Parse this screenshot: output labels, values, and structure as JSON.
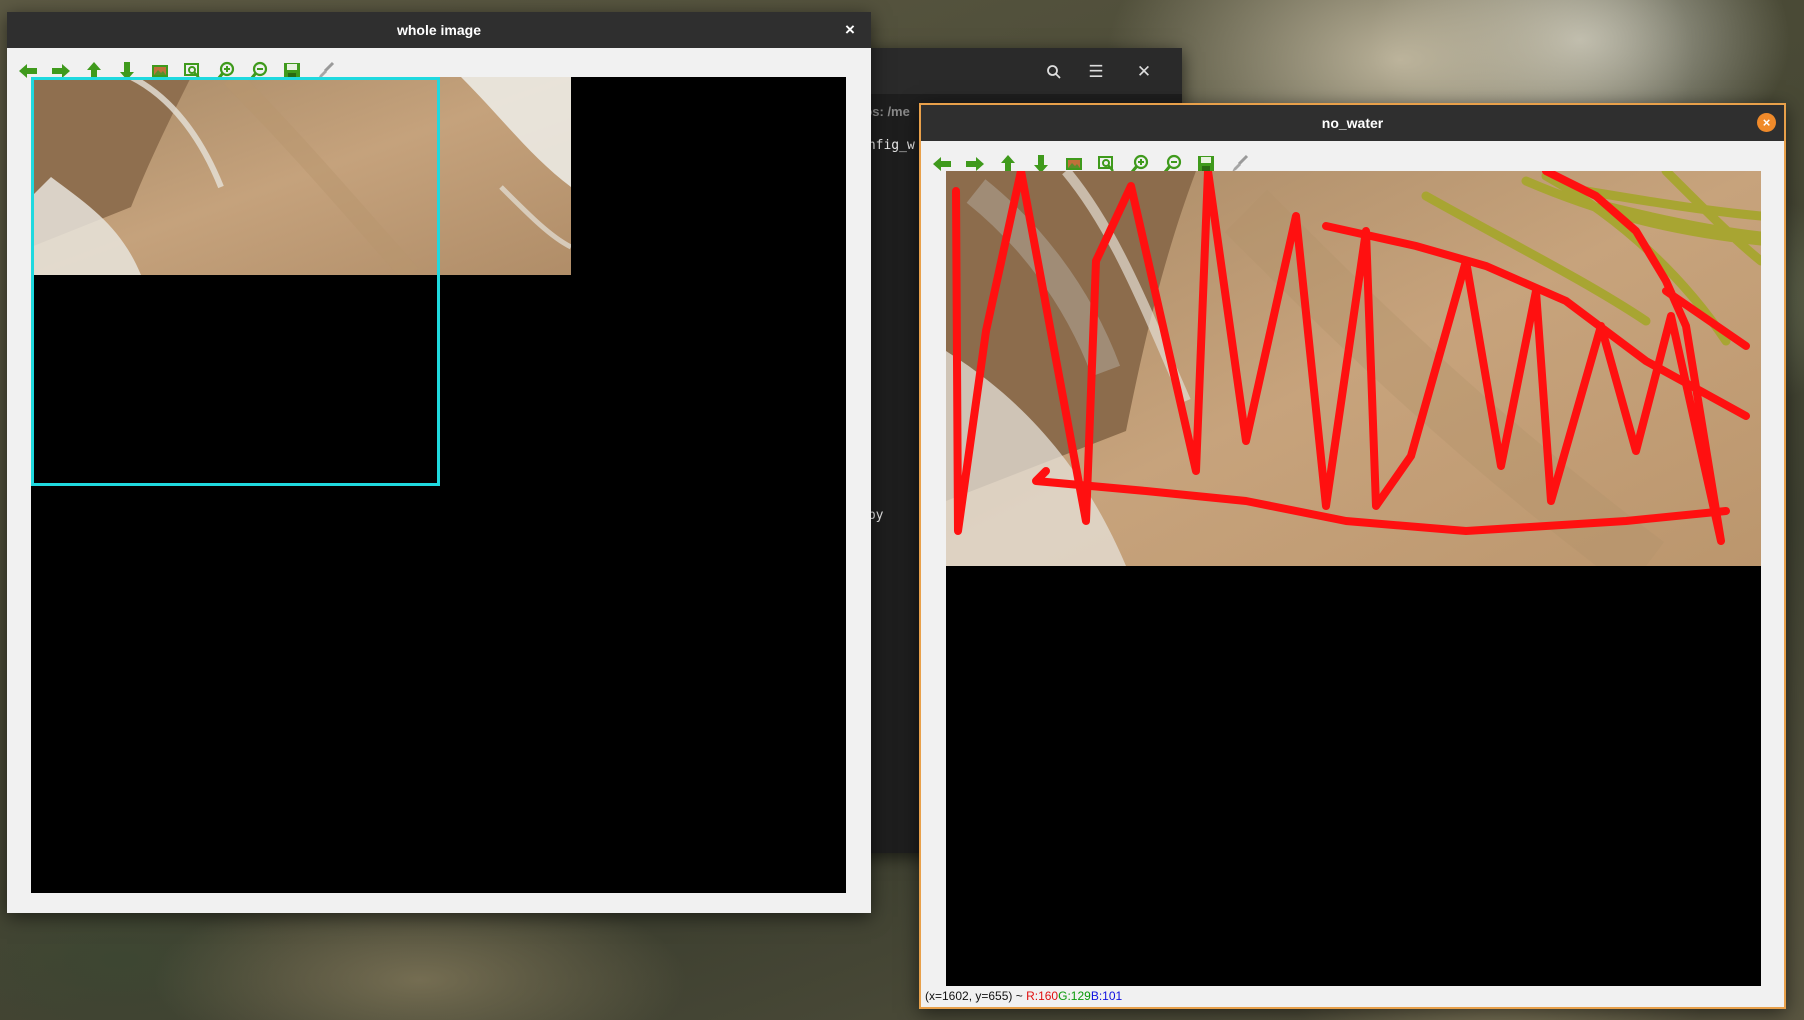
{
  "window_whole": {
    "title": "whole image",
    "close_label": "×"
  },
  "window_terminal": {
    "path_fragment": "-os: /me",
    "line1": "onfig_w",
    "line2": "opy"
  },
  "window_nowater": {
    "title": "no_water",
    "close_label": "×",
    "status": {
      "coords": "(x=1602, y=655) ~ ",
      "r": "R:160",
      "g": "G:129",
      "b": "B:101"
    }
  },
  "toolbar": {
    "icons": [
      "arrow-left-icon",
      "arrow-right-icon",
      "arrow-up-icon",
      "arrow-down-icon",
      "image-icon",
      "zoom-fit-icon",
      "zoom-in-icon",
      "zoom-out-icon",
      "save-icon",
      "brush-icon"
    ]
  },
  "colors": {
    "roi_box": "#1fd9df",
    "red_annotation": "#ff1010",
    "olive_annotation": "#a8a532",
    "window_accent": "#e8a04a",
    "icon_green": "#3f9a1c"
  }
}
